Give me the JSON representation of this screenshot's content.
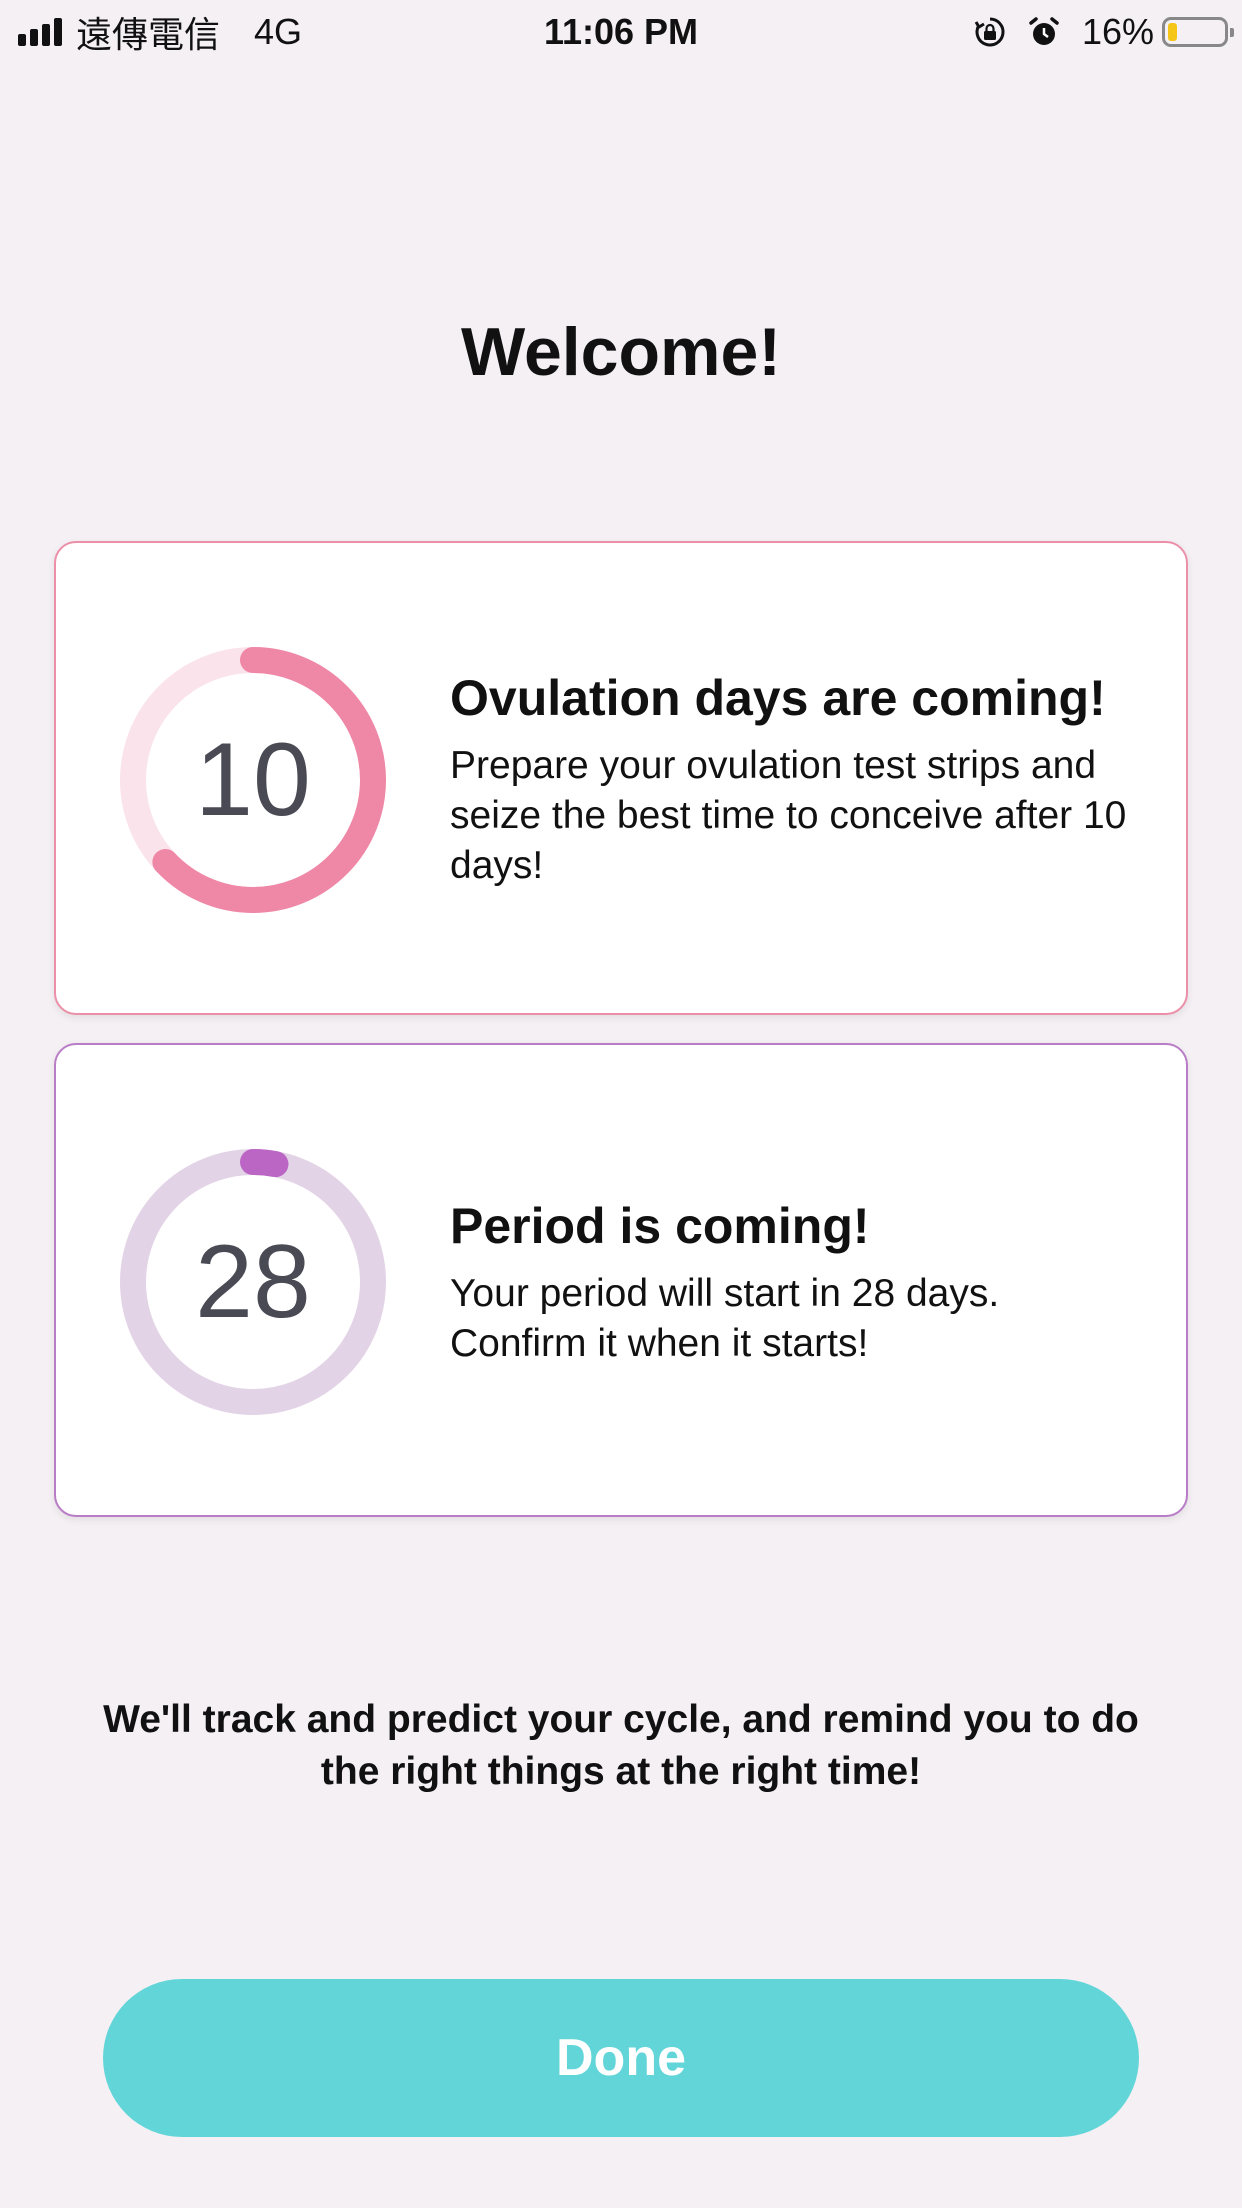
{
  "status_bar": {
    "carrier": "遠傳電信",
    "network": "4G",
    "time": "11:06 PM",
    "battery_percent": "16%",
    "battery_level": 0.16,
    "icons": [
      "signal-icon",
      "orientation-lock-icon",
      "alarm-icon",
      "battery-icon"
    ]
  },
  "page": {
    "title": "Welcome!"
  },
  "cards": [
    {
      "number": "10",
      "title": "Ovulation days are coming!",
      "body": "Prepare your ovulation test strips and seize the best time to conceive after 10 days!",
      "ring_progress": 0.63,
      "accent_color": "#ef87a6",
      "track_color": "#fae3ea",
      "border_color": "#ec8fa9"
    },
    {
      "number": "28",
      "title": "Period is coming!",
      "body": "Your period will start in 28 days. Confirm it when it starts!",
      "ring_progress": 0.03,
      "accent_color": "#bb66c4",
      "track_color": "#e3d3e6",
      "border_color": "#b97dc7"
    }
  ],
  "tagline": "We'll track and predict your cycle, and remind you to do the right things at the right time!",
  "done_button": {
    "label": "Done",
    "color": "#62d5d8"
  }
}
